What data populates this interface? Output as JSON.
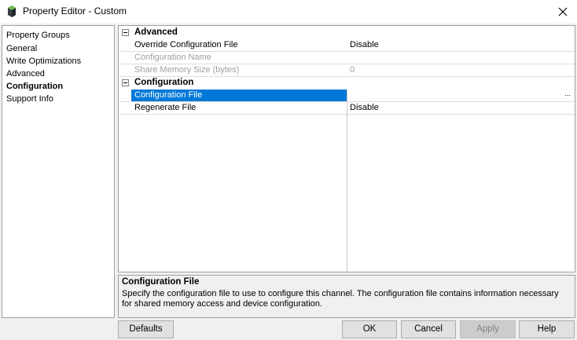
{
  "window": {
    "title": "Property Editor - Custom"
  },
  "groups": {
    "items": [
      {
        "label": "Property Groups"
      },
      {
        "label": "General"
      },
      {
        "label": "Write Optimizations"
      },
      {
        "label": "Advanced"
      },
      {
        "label": "Configuration",
        "selected": true
      },
      {
        "label": "Support Info"
      }
    ]
  },
  "grid": {
    "categories": {
      "advanced": {
        "label": "Advanced",
        "rows": [
          {
            "name": "Override Configuration File",
            "value": "Disable",
            "enabled": true
          },
          {
            "name": "Configuration Name",
            "value": "",
            "enabled": false
          },
          {
            "name": "Share Memory Size (bytes)",
            "value": "0",
            "enabled": false
          }
        ]
      },
      "configuration": {
        "label": "Configuration",
        "rows": [
          {
            "name": "Configuration File",
            "value": "",
            "enabled": true,
            "selected": true,
            "button": "..."
          },
          {
            "name": "Regenerate File",
            "value": "Disable",
            "enabled": true
          }
        ]
      }
    }
  },
  "description": {
    "title": "Configuration File",
    "text": "Specify the configuration file to use to configure this channel. The configuration file contains information necessary for shared memory access and device configuration."
  },
  "buttons": {
    "defaults": "Defaults",
    "ok": "OK",
    "cancel": "Cancel",
    "apply": "Apply",
    "help": "Help"
  },
  "colors": {
    "selection": "#0078d7",
    "disabled_text": "#a0a0a0"
  }
}
